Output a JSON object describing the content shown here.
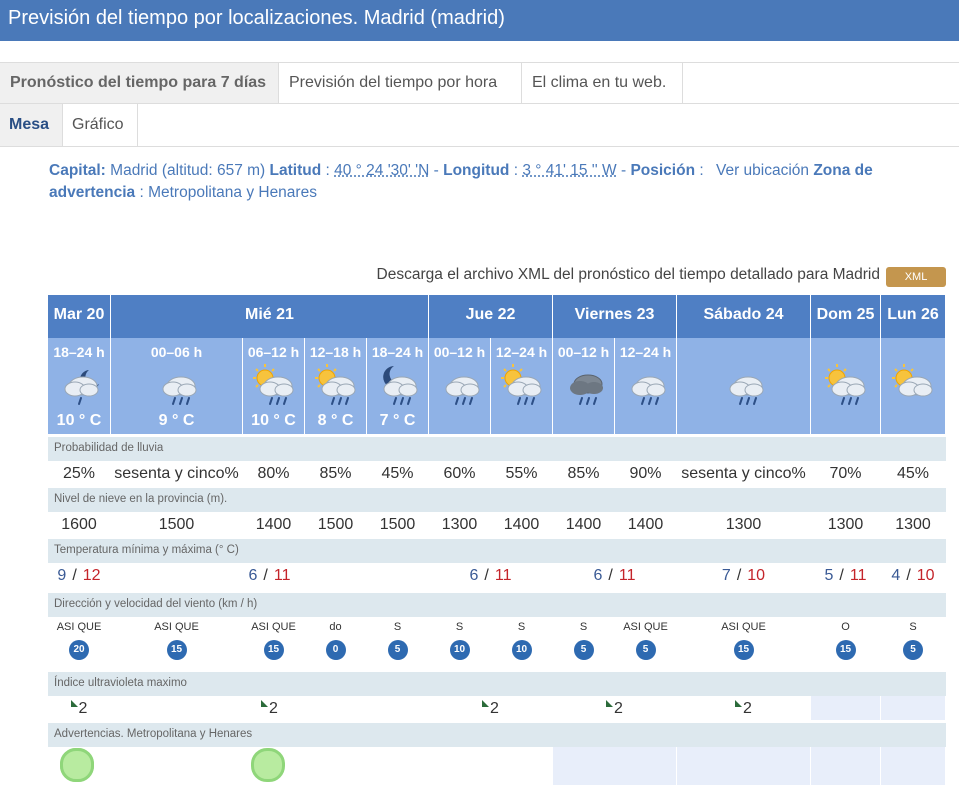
{
  "title": "Previsión del tiempo por localizaciones. Madrid (madrid)",
  "tabs": [
    "Pronóstico del tiempo para 7 días",
    "Previsión del tiempo por hora",
    "El clima en tu web."
  ],
  "subtabs": [
    "Mesa",
    "Gráfico"
  ],
  "info": {
    "capital_label": "Capital:",
    "capital_value": "Madrid (altitud: 657 m)",
    "lat_label": "Latitud",
    "lat_value": "40 ° 24 '30' 'N",
    "lon_label": "Longitud",
    "lon_value": "3 ° 41' 15 '' W",
    "pos_label": "Posición",
    "pos_link": "Ver ubicación",
    "zone_label": "Zona de advertencia",
    "zone_value": "Metropolitana y Henares"
  },
  "download_text": "Descarga el archivo XML del pronóstico del tiempo detallado para Madrid",
  "xml_label": "XML",
  "days": [
    "Mar 20",
    "Mié 21",
    "Jue 22",
    "Viernes 23",
    "Sábado 24",
    "Dom 25",
    "Lun 26"
  ],
  "periods": [
    {
      "label": "18–24 h",
      "temp": "10 ° C",
      "icon": "cloud-moon-rain-icon"
    },
    {
      "label": "00–06 h",
      "temp": "9 ° C",
      "icon": "cloud-rain-icon"
    },
    {
      "label": "06–12 h",
      "temp": "10 ° C",
      "icon": "sun-cloud-rain-icon"
    },
    {
      "label": "12–18 h",
      "temp": "8 ° C",
      "icon": "sun-cloud-rain-icon"
    },
    {
      "label": "18–24 h",
      "temp": "7 ° C",
      "icon": "moon-cloud-rain-icon"
    },
    {
      "label": "00–12 h",
      "temp": "",
      "icon": "cloud-rain-icon"
    },
    {
      "label": "12–24 h",
      "temp": "",
      "icon": "sun-cloud-rain-icon"
    },
    {
      "label": "00–12 h",
      "temp": "",
      "icon": "dark-cloud-rain-icon"
    },
    {
      "label": "12–24 h",
      "temp": "",
      "icon": "cloud-rain-icon"
    },
    {
      "label": "",
      "temp": "",
      "icon": "cloud-rain-icon"
    },
    {
      "label": "",
      "temp": "",
      "icon": "sun-cloud-rain-icon"
    },
    {
      "label": "",
      "temp": "",
      "icon": "sun-cloud-icon"
    }
  ],
  "sections": {
    "rain": "Probabilidad de lluvia",
    "snow": "Nivel de nieve en la provincia (m).",
    "temp": "Temperatura mínima y máxima (° C)",
    "wind": "Dirección y velocidad del viento (km / h)",
    "uv": "Índice ultravioleta maximo",
    "warn": "Advertencias. Metropolitana y Henares"
  },
  "rain": [
    "25%",
    "sesenta y cinco%",
    "80%",
    "85%",
    "45%",
    "60%",
    "55%",
    "85%",
    "90%",
    "sesenta y cinco%",
    "70%",
    "45%"
  ],
  "snow": [
    "1600",
    "1500",
    "1400",
    "1500",
    "1500",
    "1300",
    "1400",
    "1400",
    "1400",
    "1300",
    "1300",
    "1300"
  ],
  "temps": [
    {
      "min": "9",
      "max": "12"
    },
    {
      "min": "6",
      "max": "11"
    },
    {
      "min": "6",
      "max": "11"
    },
    {
      "min": "6",
      "max": "11"
    },
    {
      "min": "7",
      "max": "10"
    },
    {
      "min": "5",
      "max": "11"
    },
    {
      "min": "4",
      "max": "10"
    }
  ],
  "wind": [
    {
      "dir": "ASI QUE",
      "speed": "20"
    },
    {
      "dir": "ASI QUE",
      "speed": "15"
    },
    {
      "dir": "ASI QUE",
      "speed": "15"
    },
    {
      "dir": "do",
      "speed": "0"
    },
    {
      "dir": "S",
      "speed": "5"
    },
    {
      "dir": "S",
      "speed": "10"
    },
    {
      "dir": "S",
      "speed": "10"
    },
    {
      "dir": "S",
      "speed": "5"
    },
    {
      "dir": "ASI QUE",
      "speed": "5"
    },
    {
      "dir": "ASI QUE",
      "speed": "15"
    },
    {
      "dir": "O",
      "speed": "15"
    },
    {
      "dir": "S",
      "speed": "5"
    }
  ],
  "uv": [
    "2",
    "2",
    "2",
    "2",
    "2",
    "",
    ""
  ],
  "warnings": [
    "green",
    "green",
    "green",
    "",
    "",
    "",
    ""
  ],
  "colors": {
    "header": "#4a79b9",
    "day_row": "#4f7fc4",
    "period_row": "#8fb2e6",
    "section": "#dde8ee",
    "xml": "#c4964e",
    "max_temp": "#c4242a",
    "min_temp": "#3a5a95",
    "wind_bubble": "#2e6ab1",
    "warning_green": "#b8eba0"
  }
}
